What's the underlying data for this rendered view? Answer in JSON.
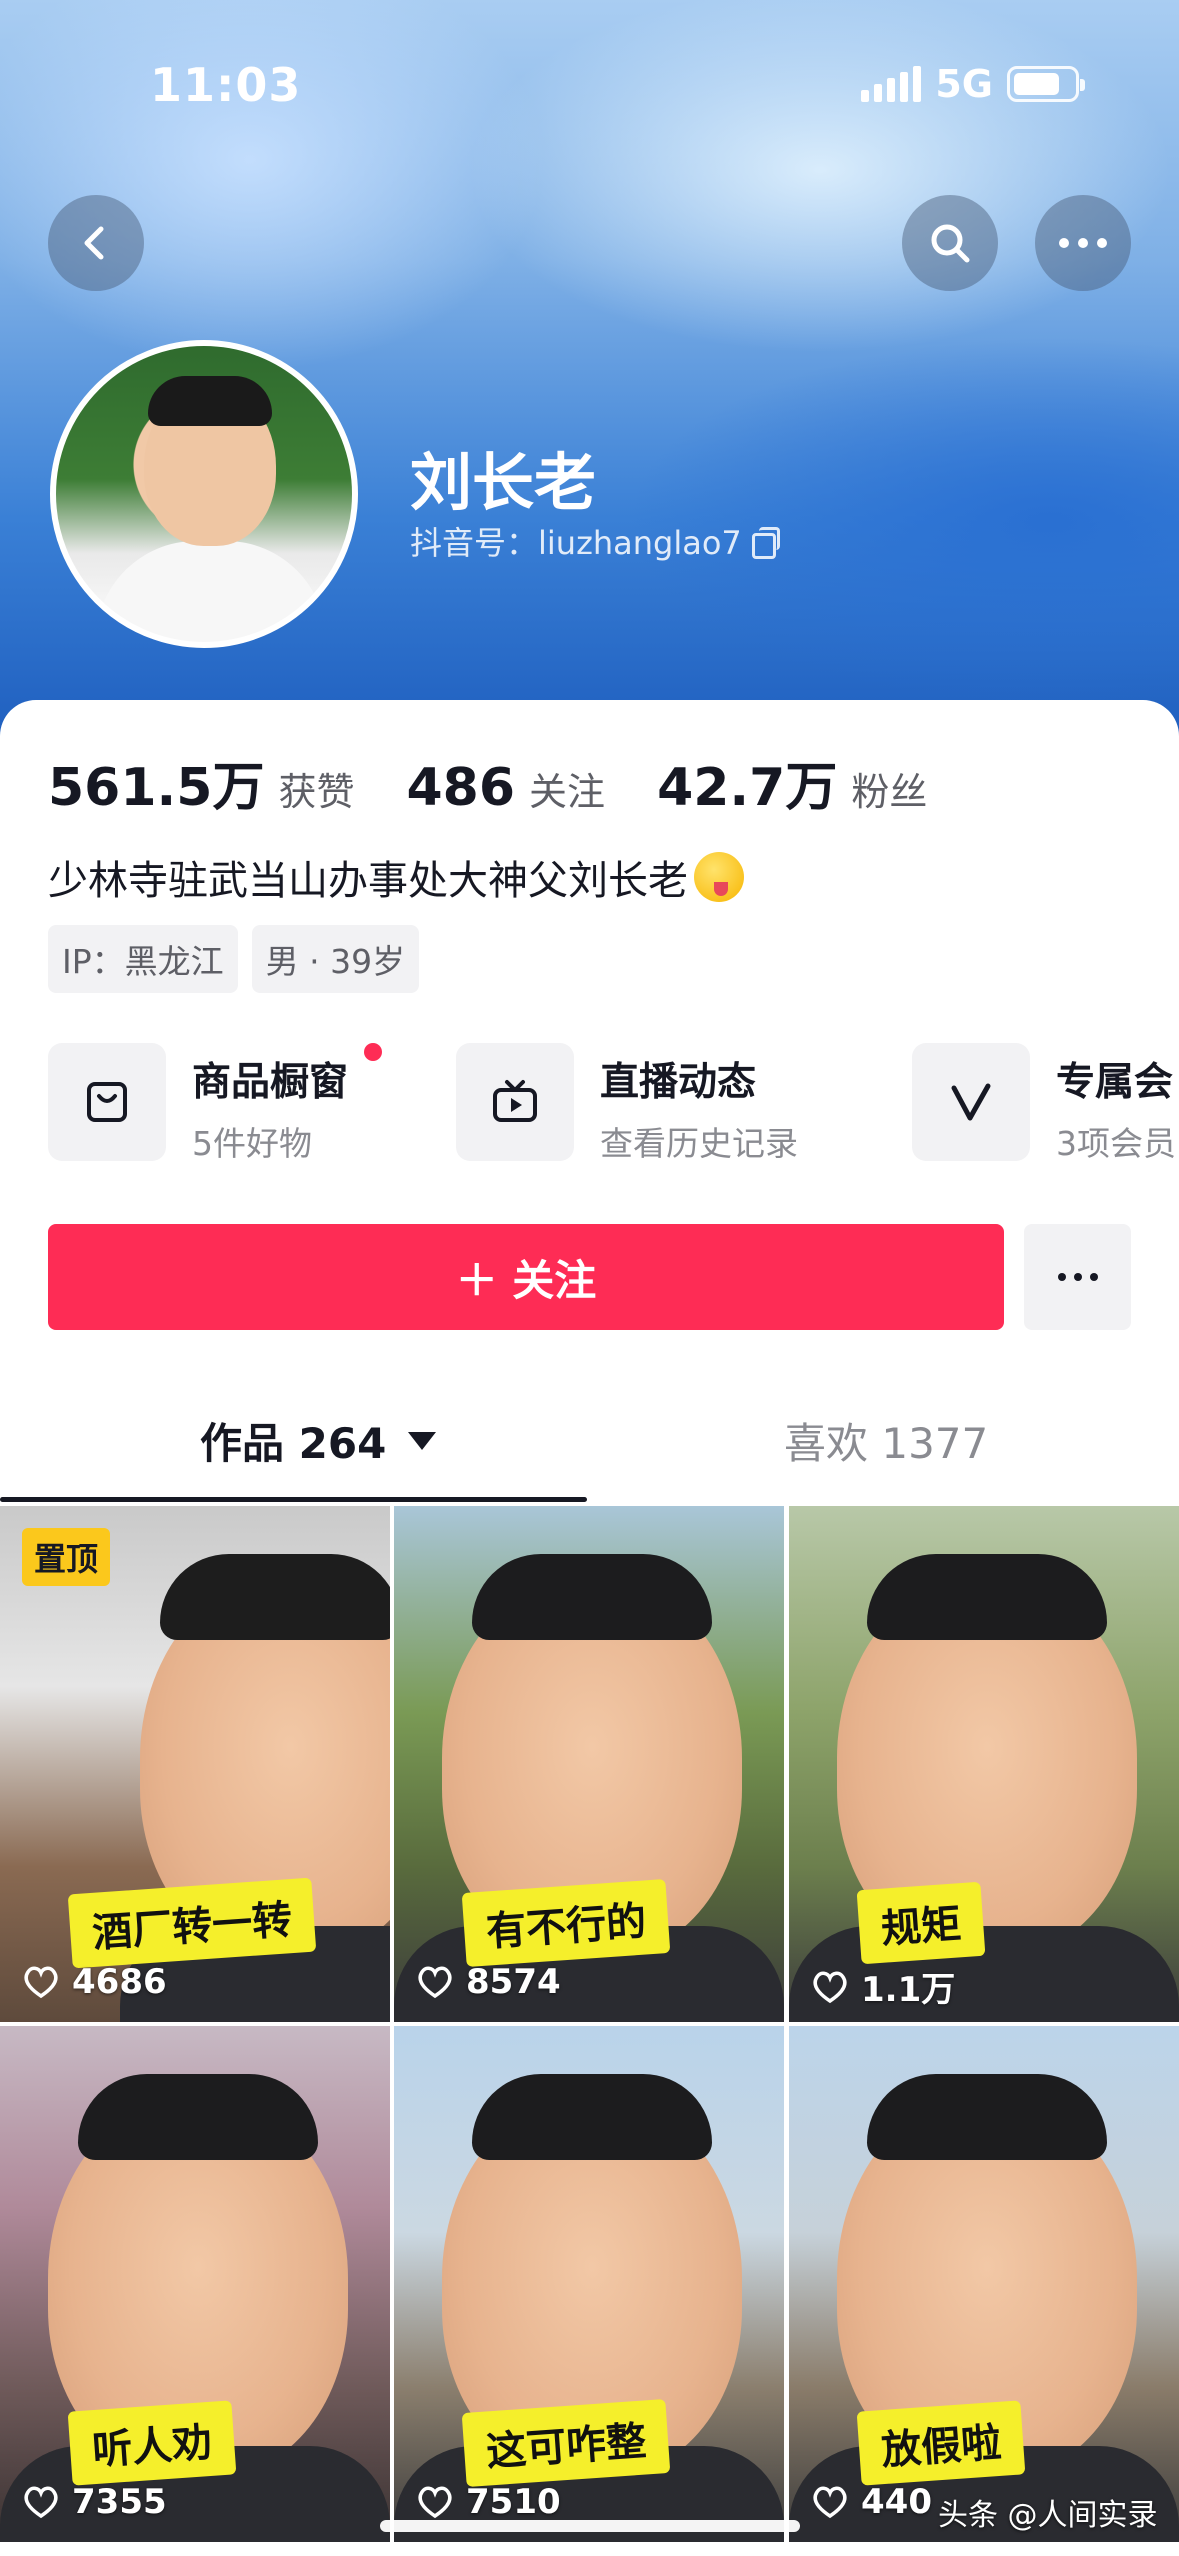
{
  "status_bar": {
    "time": "11:03",
    "network": "5G"
  },
  "profile": {
    "name": "刘长老",
    "account_label": "抖音号：liuzhanglao7",
    "stats": [
      {
        "value": "561.5万",
        "label": "获赞"
      },
      {
        "value": "486",
        "label": "关注"
      },
      {
        "value": "42.7万",
        "label": "粉丝"
      }
    ],
    "bio": "少林寺驻武当山办事处大神父刘长老",
    "tags": [
      "IP：黑龙江",
      "男 · 39岁"
    ]
  },
  "services": [
    {
      "title": "商品橱窗",
      "subtitle": "5件好物",
      "icon": "shopping-bag-icon"
    },
    {
      "title": "直播动态",
      "subtitle": "查看历史记录",
      "icon": "tv-icon"
    },
    {
      "title": "专属会",
      "subtitle": "3项会员",
      "icon": "v-icon"
    }
  ],
  "actions": {
    "follow_label": "＋ 关注"
  },
  "tabs": {
    "works_label": "作品 264",
    "likes_label": "喜欢 1377"
  },
  "videos": [
    {
      "caption": "酒厂转一转",
      "likes": "4686",
      "pinned": "置顶"
    },
    {
      "caption": "有不行的",
      "likes": "8574"
    },
    {
      "caption": "规矩",
      "likes": "1.1万"
    },
    {
      "caption": "听人劝",
      "likes": "7355"
    },
    {
      "caption": "这可咋整",
      "likes": "7510"
    },
    {
      "caption": "放假啦",
      "likes": "440"
    }
  ],
  "watermark": "头条 @人间实录",
  "colors": {
    "accent": "#fe2c55",
    "pin": "#fbc81c",
    "caption": "#f5ef2b"
  }
}
